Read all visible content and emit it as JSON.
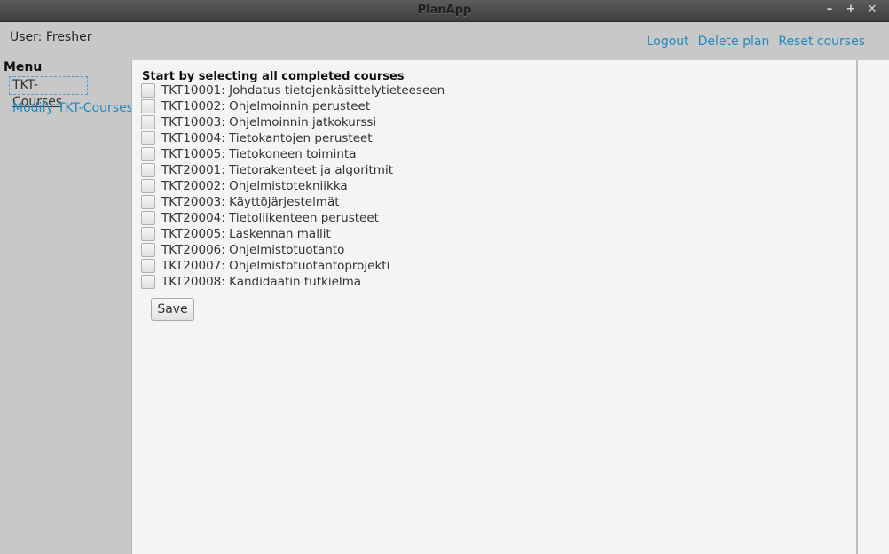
{
  "window": {
    "title": "PlanApp",
    "controls": {
      "minimize": "–",
      "maximize": "+",
      "close": "✕"
    }
  },
  "header": {
    "user_label": "User: Fresher",
    "links": {
      "logout": "Logout",
      "delete_plan": "Delete plan",
      "reset_courses": "Reset courses"
    }
  },
  "menu": {
    "title": "Menu",
    "items": [
      {
        "label": "TKT-Courses",
        "active": true
      },
      {
        "label": "Modify TKT-Courses",
        "active": false
      }
    ]
  },
  "main": {
    "instruction": "Start by selecting all completed courses",
    "courses": [
      {
        "label": "TKT10001: Johdatus tietojenkäsittelytieteeseen",
        "checked": false
      },
      {
        "label": "TKT10002: Ohjelmoinnin perusteet",
        "checked": false
      },
      {
        "label": "TKT10003: Ohjelmoinnin jatkokurssi",
        "checked": false
      },
      {
        "label": "TKT10004: Tietokantojen perusteet",
        "checked": false
      },
      {
        "label": "TKT10005: Tietokoneen toiminta",
        "checked": false
      },
      {
        "label": "TKT20001: Tietorakenteet ja algoritmit",
        "checked": false
      },
      {
        "label": "TKT20002: Ohjelmistotekniikka",
        "checked": false
      },
      {
        "label": "TKT20003: Käyttöjärjestelmät",
        "checked": false
      },
      {
        "label": "TKT20004: Tietoliikenteen perusteet",
        "checked": false
      },
      {
        "label": "TKT20005: Laskennan mallit",
        "checked": false
      },
      {
        "label": "TKT20006: Ohjelmistotuotanto",
        "checked": false
      },
      {
        "label": "TKT20007: Ohjelmistotuotantoprojekti",
        "checked": false
      },
      {
        "label": "TKT20008: Kandidaatin tutkielma",
        "checked": false
      }
    ],
    "save_label": "Save"
  },
  "colors": {
    "link": "#1f8ac2",
    "focus_border": "#4a9ad4"
  }
}
